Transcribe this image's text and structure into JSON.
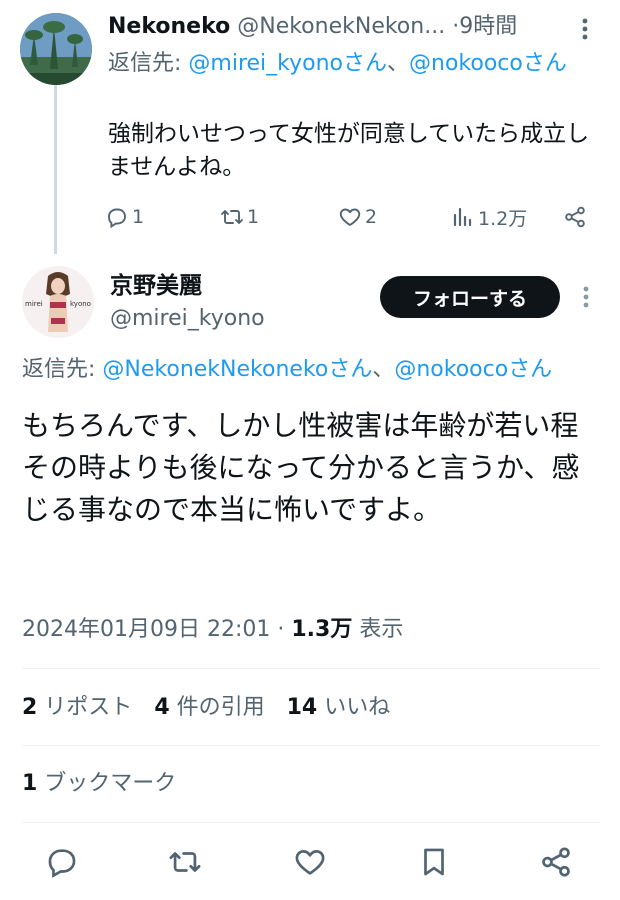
{
  "reply_tweet": {
    "name": "Nekoneko",
    "handle": "@NekonekNekon...",
    "separator": "·",
    "time": "9時間",
    "replying_prefix": "返信先: ",
    "replying_mention_1": "@mirei_kyonoさん",
    "replying_sep": "、",
    "replying_mention_2": "@nokoocoさん",
    "body": "強制わいせつって女性が同意していたら成立しませんよね。",
    "actions": {
      "replies": "1",
      "reposts": "1",
      "likes": "2",
      "views": "1.2万"
    }
  },
  "main_tweet": {
    "name": "京野美麗",
    "handle": "@mirei_kyono",
    "follow_label": "フォローする",
    "avatar_text": "mirei kyono",
    "replying_prefix": "返信先: ",
    "replying_mention_1": "@NekonekNekonekoさん",
    "replying_sep": "、",
    "replying_mention_2": "@nokoocoさん",
    "body": "もちろんです、しかし性被害は年齢が若い程その時よりも後になって分かると言うか、感じる事なので本当に怖いですよ。",
    "timestamp": "2024年01月09日 22:01",
    "meta_sep": " · ",
    "views_count": "1.3万",
    "views_label": " 表示"
  },
  "stats": {
    "reposts_count": "2",
    "reposts_label": " リポスト",
    "quotes_count": "4",
    "quotes_label": " 件の引用",
    "likes_count": "14",
    "likes_label": " いいね",
    "bookmarks_count": "1",
    "bookmarks_label": " ブックマーク"
  },
  "icons": {
    "reply": "reply-icon",
    "repost": "repost-icon",
    "like": "heart-icon",
    "views": "views-icon",
    "share": "share-icon",
    "bookmark": "bookmark-icon",
    "more": "more-icon"
  },
  "colors": {
    "text": "#0f1419",
    "secondary": "#536471",
    "link": "#1d9bf0",
    "button_bg": "#0f1419",
    "divider": "#eff3f4"
  }
}
